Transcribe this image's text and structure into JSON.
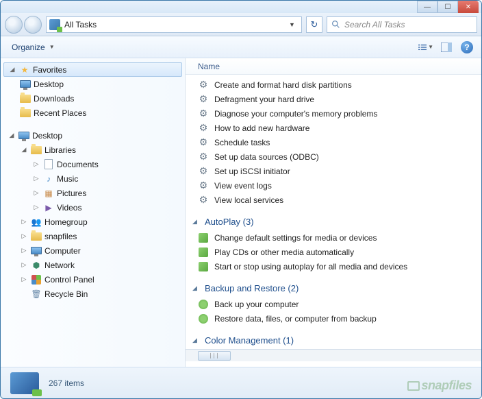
{
  "window": {
    "title": "All Tasks"
  },
  "address": {
    "path": "All Tasks"
  },
  "search": {
    "placeholder": "Search All Tasks"
  },
  "toolbar": {
    "organize": "Organize"
  },
  "sidebar": {
    "favorites": {
      "label": "Favorites",
      "items": [
        "Desktop",
        "Downloads",
        "Recent Places"
      ]
    },
    "desktop": {
      "label": "Desktop",
      "libraries": {
        "label": "Libraries",
        "items": [
          "Documents",
          "Music",
          "Pictures",
          "Videos"
        ]
      },
      "items": [
        "Homegroup",
        "snapfiles",
        "Computer",
        "Network",
        "Control Panel",
        "Recycle Bin"
      ]
    }
  },
  "main": {
    "column": "Name",
    "ungrouped": [
      "Create and format hard disk partitions",
      "Defragment your hard drive",
      "Diagnose your computer's memory problems",
      "How to add new hardware",
      "Schedule tasks",
      "Set up data sources (ODBC)",
      "Set up iSCSI initiator",
      "View event logs",
      "View local services"
    ],
    "groups": [
      {
        "label": "AutoPlay (3)",
        "items": [
          "Change default settings for media or devices",
          "Play CDs or other media automatically",
          "Start or stop using autoplay for all media and devices"
        ]
      },
      {
        "label": "Backup and Restore (2)",
        "items": [
          "Back up your computer",
          "Restore data, files, or computer from backup"
        ]
      },
      {
        "label": "Color Management (1)",
        "items": []
      }
    ]
  },
  "status": {
    "count": "267 items"
  },
  "watermark": "snapfiles"
}
